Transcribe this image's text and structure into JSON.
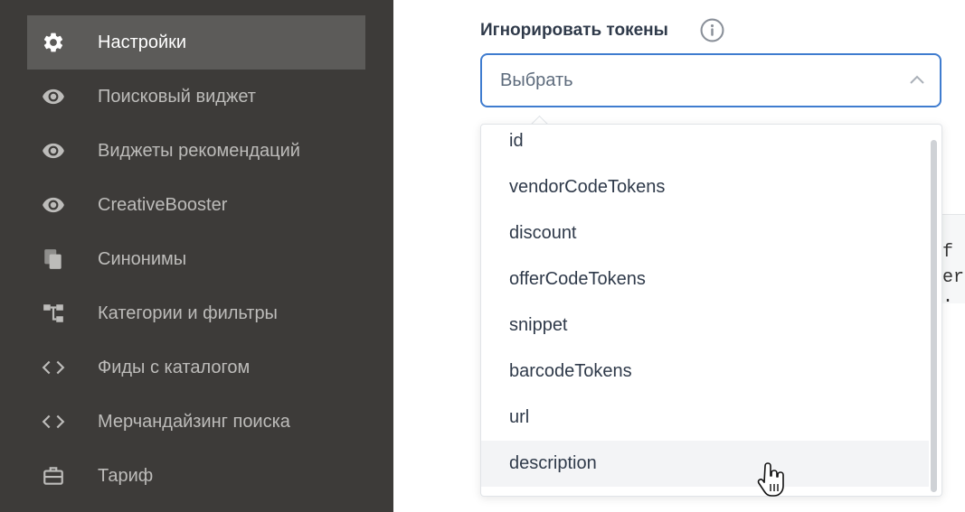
{
  "sidebar": {
    "items": [
      {
        "label": "Настройки",
        "icon": "gear-icon",
        "active": true
      },
      {
        "label": "Поисковый виджет",
        "icon": "eye-icon"
      },
      {
        "label": "Виджеты рекомендаций",
        "icon": "eye-icon"
      },
      {
        "label": "CreativeBooster",
        "icon": "eye-icon"
      },
      {
        "label": "Синонимы",
        "icon": "copy-icon"
      },
      {
        "label": "Категории и фильтры",
        "icon": "hierarchy-icon"
      },
      {
        "label": "Фиды с каталогом",
        "icon": "code-icon"
      },
      {
        "label": "Мерчандайзинг поиска",
        "icon": "code-icon"
      },
      {
        "label": "Тариф",
        "icon": "briefcase-icon"
      }
    ]
  },
  "field": {
    "label": "Игнорировать токены",
    "info_icon": "info-icon",
    "select_placeholder": "Выбрать",
    "chevron_icon": "chevron-up-icon"
  },
  "dropdown": {
    "options": [
      "id",
      "vendorCodeTokens",
      "discount",
      "offerCodeTokens",
      "snippet",
      "barcodeTokens",
      "url",
      "description"
    ],
    "hovered_option": "description"
  },
  "background_code": {
    "lines": [
      "f =",
      "er.",
      "."
    ]
  },
  "colors": {
    "sidebar_bg": "#3d3b39",
    "sidebar_active_bg": "#5c5b59",
    "accent_border": "#3f7ccf",
    "text_dark": "#2f3a4a"
  }
}
